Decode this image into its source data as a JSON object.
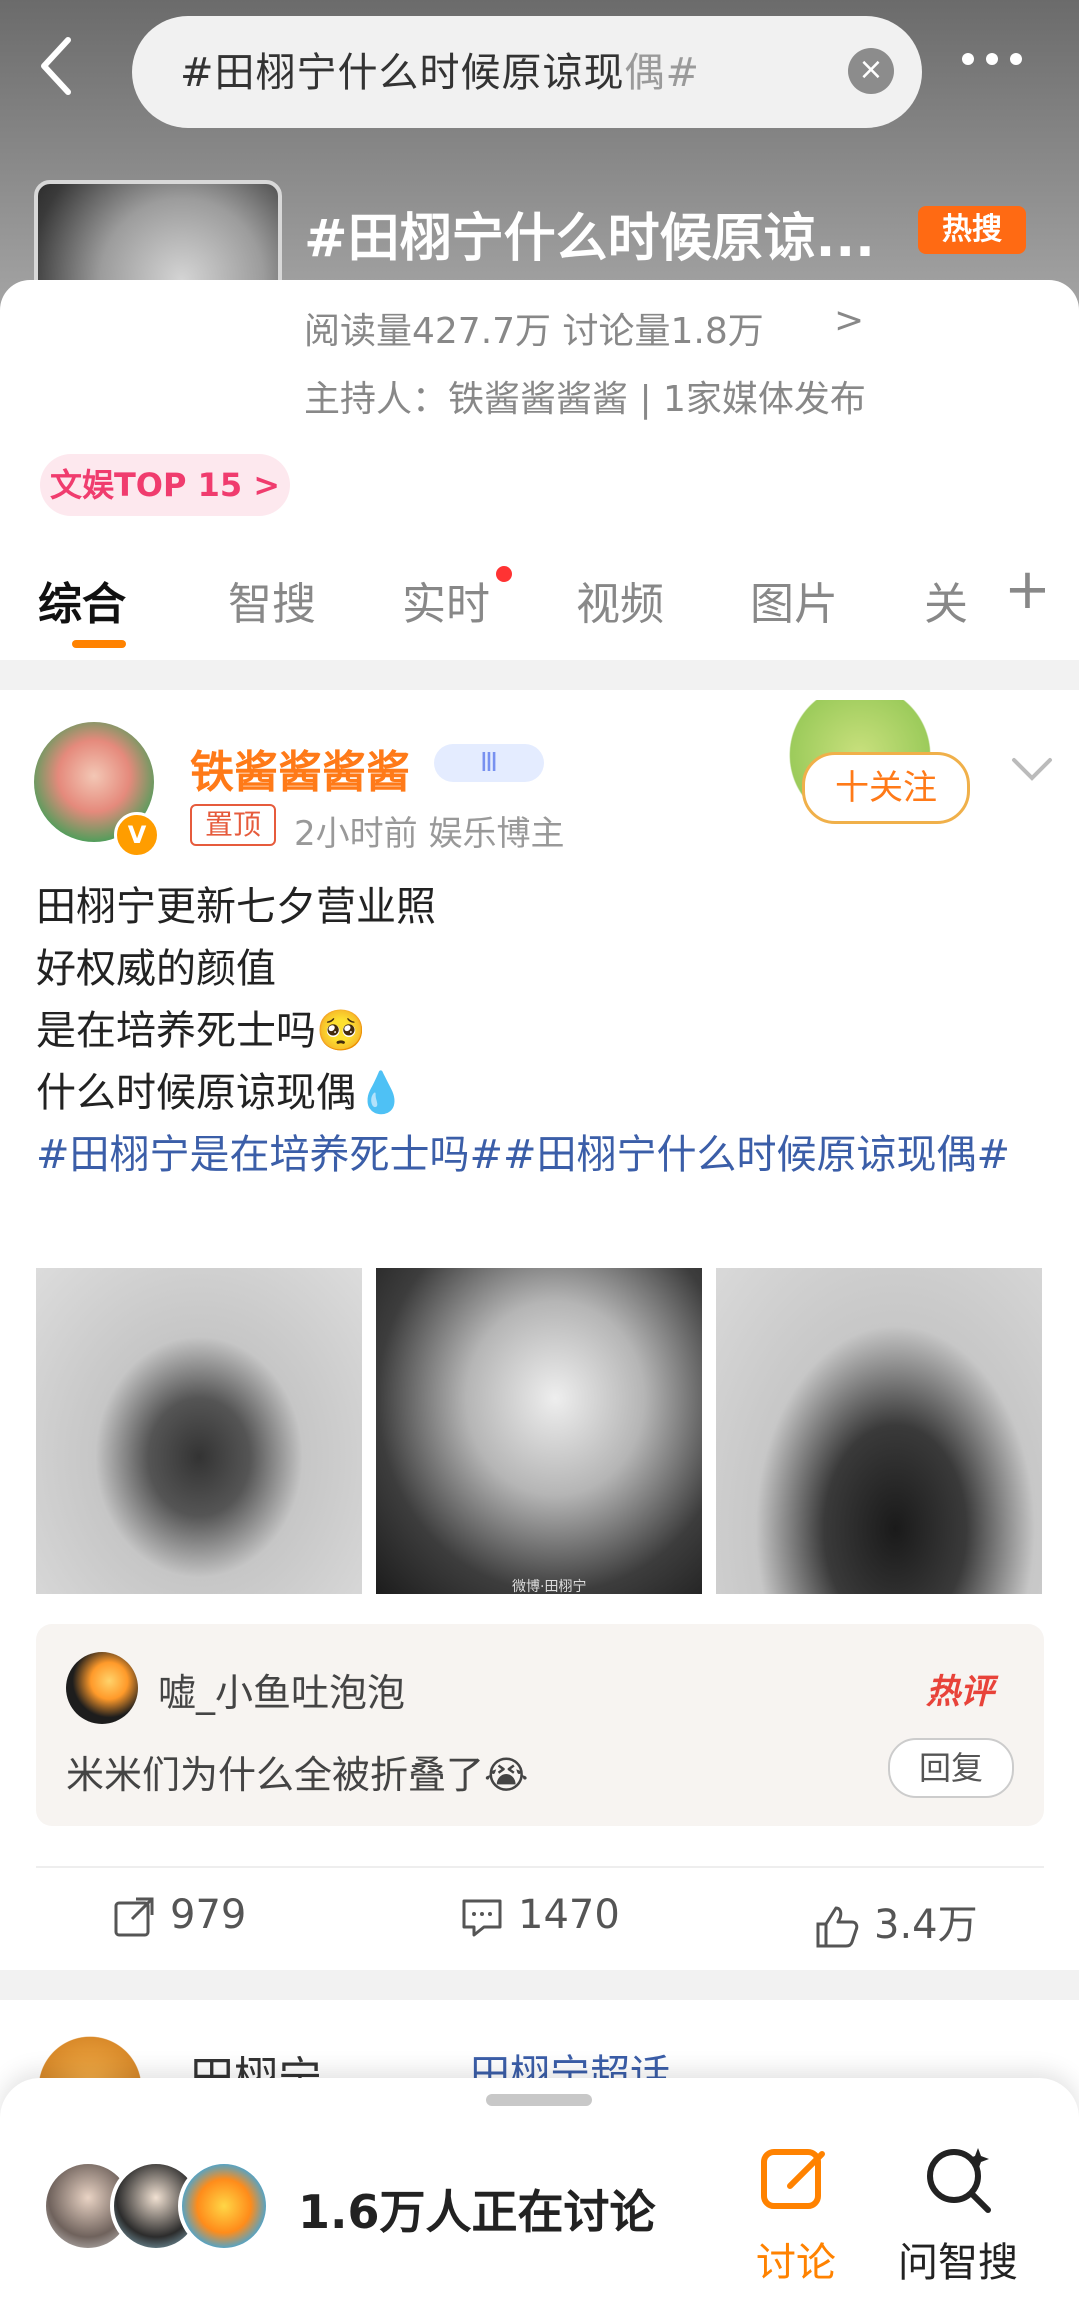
{
  "header": {
    "search_query": "#田栩宁什么时候原谅现",
    "search_query_tail": "偶#",
    "topic_title": "#田栩宁什么时候原谅...",
    "hot_badge": "热搜"
  },
  "topic": {
    "stats": "阅读量427.7万  讨论量1.8万",
    "stats_arrow": ">",
    "host": "主持人：铁酱酱酱酱 | 1家媒体发布",
    "rank_badge": "文娱TOP 15 >"
  },
  "tabs": [
    {
      "label": "综合"
    },
    {
      "label": "智搜"
    },
    {
      "label": "实时"
    },
    {
      "label": "视频"
    },
    {
      "label": "图片"
    },
    {
      "label": "关"
    }
  ],
  "post": {
    "author": "铁酱酱酱酱",
    "level": "Ⅲ",
    "pinned": "置顶",
    "meta": "2小时前   娱乐博主",
    "follow_label": "十关注",
    "lines": [
      "田栩宁更新七夕营业照",
      "好权威的颜值",
      "是在培养死士吗🥺",
      "什么时候原谅现偶💧"
    ],
    "tags": "#田栩宁是在培养死士吗##田栩宁什么时候原谅现偶#",
    "watermark": "微博·田栩宁",
    "hot_comment": {
      "user": "嘘_小鱼吐泡泡",
      "hot_label": "热评",
      "text": "米米们为什么全被折叠了😭",
      "reply_label": "回复"
    },
    "actions": {
      "repost": "979",
      "comment": "1470",
      "like": "3.4万"
    }
  },
  "next_post": {
    "author": "田栩宁",
    "super_topic": "田栩宁超话"
  },
  "bottom_sheet": {
    "discussing": "1.6万人正在讨论",
    "discuss_label": "讨论",
    "ask_label": "问智搜"
  },
  "colors": {
    "accent": "#ff8200",
    "link": "#3b5ea8",
    "hot_badge": "#ff6a13",
    "author": "#ff7a18"
  }
}
